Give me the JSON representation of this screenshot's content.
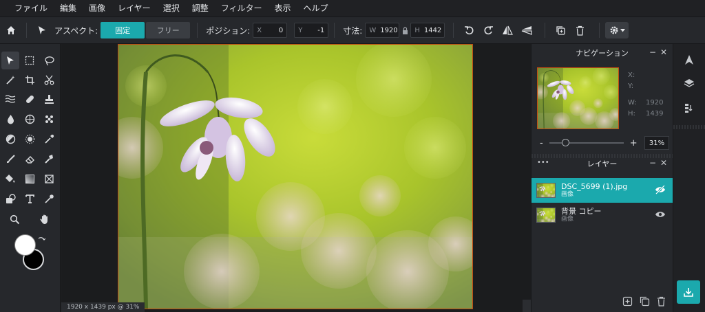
{
  "menu": [
    "ファイル",
    "編集",
    "画像",
    "レイヤー",
    "選択",
    "調整",
    "フィルター",
    "表示",
    "ヘルプ"
  ],
  "toolbar": {
    "aspect_label": "アスペクト:",
    "fixed_label": "固定",
    "free_label": "フリー",
    "position_label": "ポジション:",
    "x_key": "X",
    "x_value": "0",
    "y_key": "Y",
    "y_value": "-1",
    "size_label": "寸法:",
    "w_key": "W",
    "w_value": "1920",
    "h_key": "H",
    "h_value": "1442"
  },
  "canvas": {
    "status": "1920 x 1439 px @ 31%"
  },
  "navigation": {
    "title": "ナビゲーション",
    "x_label": "X:",
    "y_label": "Y:",
    "w_label": "W:",
    "w_value": "1920",
    "h_label": "H:",
    "h_value": "1439",
    "zoom_minus": "-",
    "zoom_plus": "+",
    "zoom_value": "31%",
    "zoom_level": 0.22
  },
  "layers": {
    "title": "レイヤー",
    "more": "•••",
    "items": [
      {
        "name": "DSC_5699 (1).jpg",
        "type": "画像"
      },
      {
        "name": "背景 コピー",
        "type": "画像"
      }
    ]
  },
  "colors": {
    "accent": "#1ba9ad",
    "selection_border": "#c24a12",
    "primary": "#ffffff",
    "secondary": "#000000"
  }
}
